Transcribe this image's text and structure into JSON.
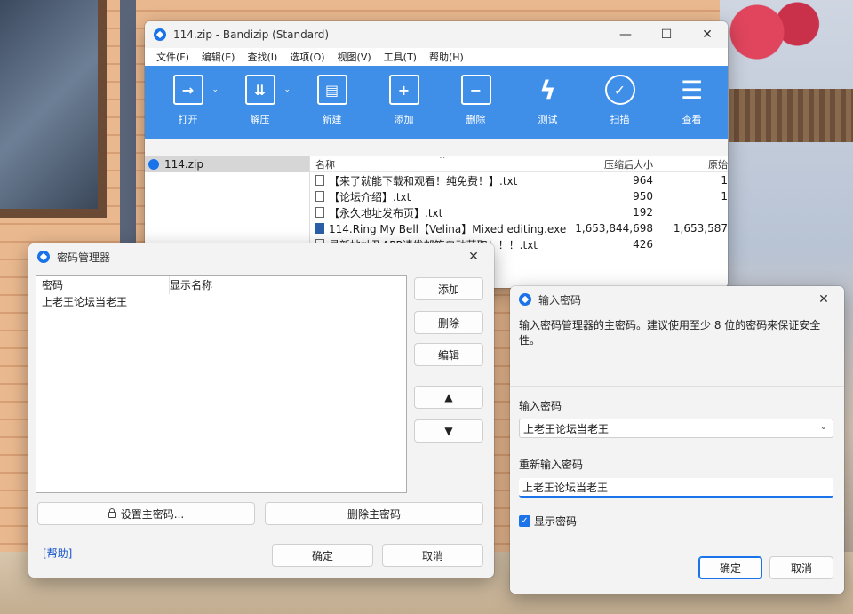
{
  "main": {
    "title": "114.zip - Bandizip (Standard)",
    "menu": [
      "文件(F)",
      "编辑(E)",
      "查找(I)",
      "选项(O)",
      "视图(V)",
      "工具(T)",
      "帮助(H)"
    ],
    "toolbar": [
      {
        "label": "打开",
        "icon": "open-icon",
        "glyph": "→",
        "caret": true
      },
      {
        "label": "解压",
        "icon": "extract-icon",
        "glyph": "⇊",
        "caret": true
      },
      {
        "label": "新建",
        "icon": "new-archive-icon",
        "glyph": "▤",
        "caret": false
      },
      {
        "label": "添加",
        "icon": "add-icon",
        "glyph": "+",
        "caret": false
      },
      {
        "label": "删除",
        "icon": "delete-icon",
        "glyph": "−",
        "caret": false
      },
      {
        "label": "测试",
        "icon": "test-icon",
        "glyph": "ϟ",
        "caret": false
      },
      {
        "label": "扫描",
        "icon": "scan-shield-icon",
        "glyph": "✓",
        "caret": false
      },
      {
        "label": "查看",
        "icon": "view-list-icon",
        "glyph": "☰",
        "caret": false
      }
    ],
    "tree_item": "114.zip",
    "columns": {
      "name": "名称",
      "packed": "压缩后大小",
      "original": "原始"
    },
    "files": [
      {
        "name": "【来了就能下载和观看！纯免费！】.txt",
        "packed": "964",
        "original": "1",
        "type": "txt"
      },
      {
        "name": "【论坛介绍】.txt",
        "packed": "950",
        "original": "1",
        "type": "txt"
      },
      {
        "name": "【永久地址发布页】.txt",
        "packed": "192",
        "original": "",
        "type": "txt"
      },
      {
        "name": "114.Ring My Bell【Velina】Mixed editing.exe",
        "packed": "1,653,844,698",
        "original": "1,653,587",
        "type": "exe"
      },
      {
        "name": "最新地址及APP请发邮箱自动获取！！！.txt",
        "packed": "426",
        "original": "",
        "type": "txt"
      }
    ]
  },
  "password_manager": {
    "title": "密码管理器",
    "col_password": "密码",
    "col_display": "显示名称",
    "rows": [
      {
        "password": "上老王论坛当老王",
        "display": ""
      }
    ],
    "btn_add": "添加",
    "btn_delete": "删除",
    "btn_edit": "编辑",
    "btn_up": "▲",
    "btn_down": "▼",
    "btn_set_master": "设置主密码...",
    "btn_delete_master": "删除主密码",
    "help": "[帮助]",
    "btn_ok": "确定",
    "btn_cancel": "取消"
  },
  "enter_password": {
    "title": "输入密码",
    "description": "输入密码管理器的主密码。建议使用至少 8 位的密码来保证安全性。",
    "label_password": "输入密码",
    "password_value": "上老王论坛当老王",
    "label_repeat": "重新输入密码",
    "repeat_value": "上老王论坛当老王",
    "show_password": "显示密码",
    "show_password_checked": true,
    "btn_ok": "确定",
    "btn_cancel": "取消"
  },
  "colors": {
    "accent": "#1a73e8",
    "toolbar": "#3f8fe8"
  }
}
